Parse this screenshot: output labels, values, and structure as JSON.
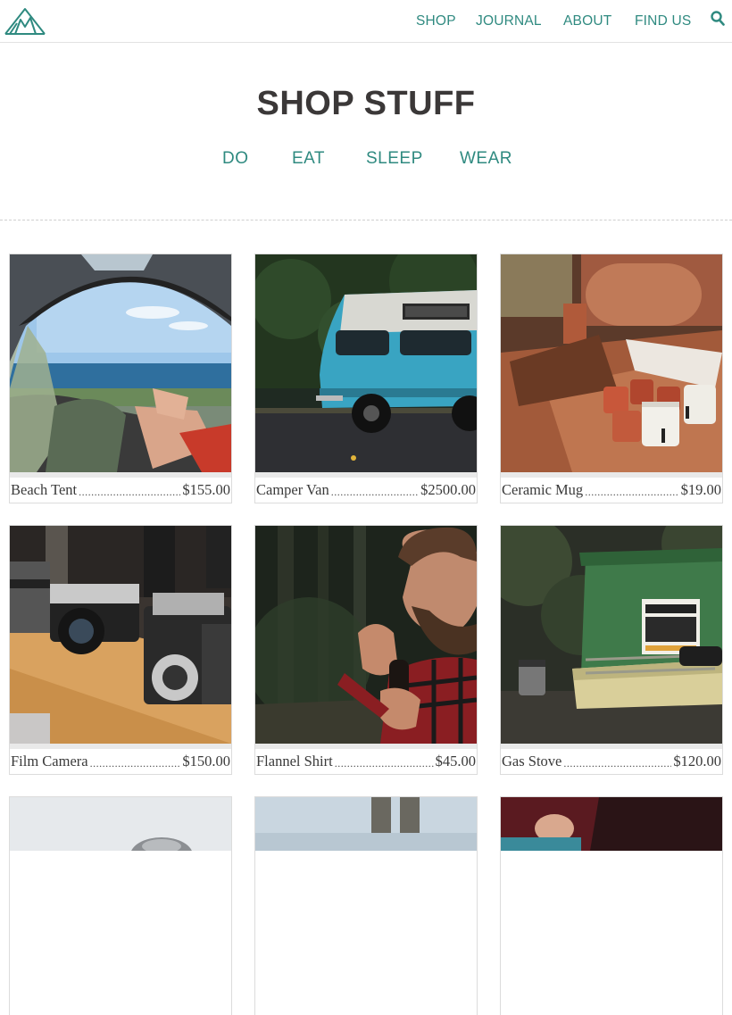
{
  "header": {
    "logo_icon": "tent-icon",
    "nav": [
      "SHOP",
      "JOURNAL",
      "ABOUT",
      "FIND US"
    ],
    "search_icon": "search-icon"
  },
  "page": {
    "title": "SHOP STUFF",
    "categories": [
      "DO",
      "EAT",
      "SLEEP",
      "WEAR"
    ]
  },
  "products": [
    {
      "name": "Beach Tent",
      "price": "$155.00",
      "image": "tent-beach-photo"
    },
    {
      "name": "Camper Van",
      "price": "$2500.00",
      "image": "blue-van-photo"
    },
    {
      "name": "Ceramic Mug",
      "price": "$19.00",
      "image": "mugs-table-photo"
    },
    {
      "name": "Film Camera",
      "price": "$150.00",
      "image": "cameras-shelf-photo"
    },
    {
      "name": "Flannel Shirt",
      "price": "$45.00",
      "image": "man-pipe-photo"
    },
    {
      "name": "Gas Stove",
      "price": "$120.00",
      "image": "camp-stove-photo"
    }
  ],
  "colors": {
    "accent": "#2f8a80",
    "title": "#3b3838"
  }
}
